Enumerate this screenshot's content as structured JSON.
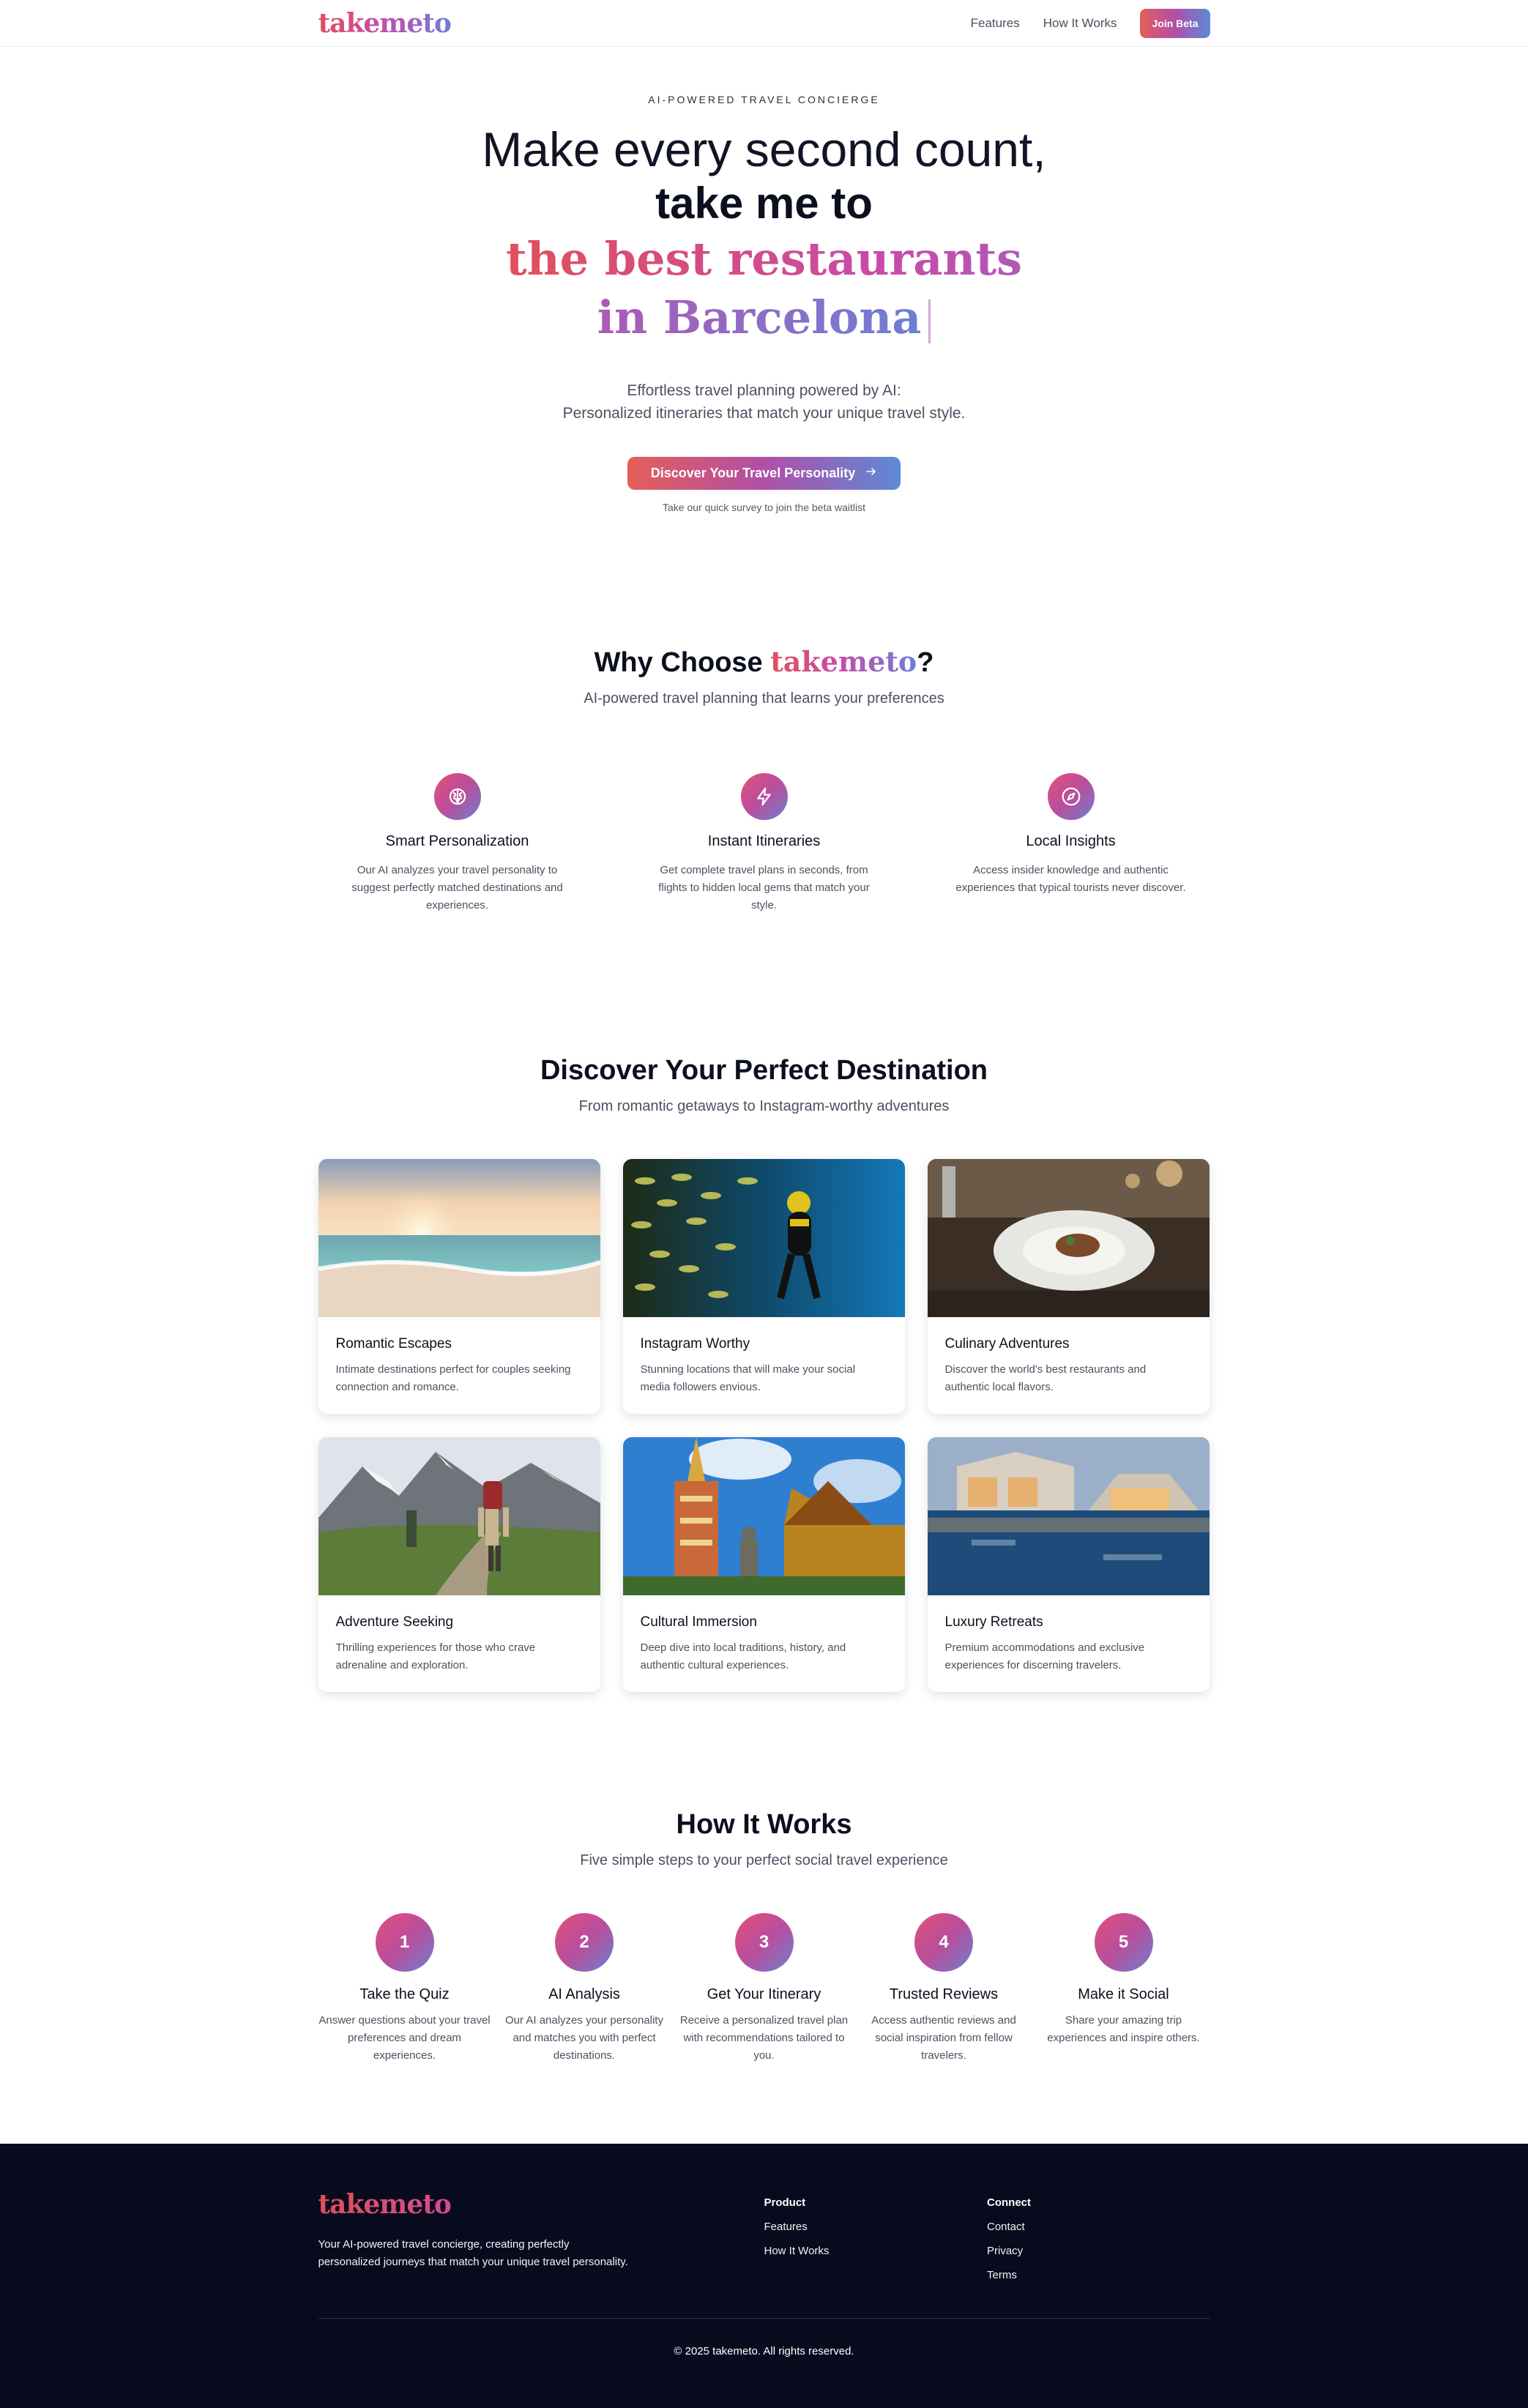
{
  "nav": {
    "logo": "takemeto",
    "links": [
      "Features",
      "How It Works"
    ],
    "cta": "Join Beta"
  },
  "hero": {
    "eyebrow": "AI-POWERED TRAVEL CONCIERGE",
    "line1": "Make every second count,",
    "line2": "take me to",
    "line3": "the best restaurants in Barcelona",
    "sub1": "Effortless travel planning powered by AI:",
    "sub2": "Personalized itineraries that match your unique travel style.",
    "cta": "Discover Your Travel Personality",
    "cta_icon": "arrow-right-icon",
    "note": "Take our quick survey to join the beta waitlist"
  },
  "why": {
    "title_prefix": "Why Choose ",
    "title_brand": "takemeto",
    "title_suffix": "?",
    "subtitle": "AI-powered travel planning that learns your preferences",
    "features": [
      {
        "icon": "brain-icon",
        "title": "Smart Personalization",
        "desc": "Our AI analyzes your travel personality to suggest perfectly matched destinations and experiences."
      },
      {
        "icon": "lightning-icon",
        "title": "Instant Itineraries",
        "desc": "Get complete travel plans in seconds, from flights to hidden local gems that match your style."
      },
      {
        "icon": "compass-icon",
        "title": "Local Insights",
        "desc": "Access insider knowledge and authentic experiences that typical tourists never discover."
      }
    ]
  },
  "destinations": {
    "title": "Discover Your Perfect Destination",
    "subtitle": "From romantic getaways to Instagram-worthy adventures",
    "cards": [
      {
        "title": "Romantic Escapes",
        "desc": "Intimate destinations perfect for couples seeking connection and romance."
      },
      {
        "title": "Instagram Worthy",
        "desc": "Stunning locations that will make your social media followers envious."
      },
      {
        "title": "Culinary Adventures",
        "desc": "Discover the world's best restaurants and authentic local flavors."
      },
      {
        "title": "Adventure Seeking",
        "desc": "Thrilling experiences for those who crave adrenaline and exploration."
      },
      {
        "title": "Cultural Immersion",
        "desc": "Deep dive into local traditions, history, and authentic cultural experiences."
      },
      {
        "title": "Luxury Retreats",
        "desc": "Premium accommodations and exclusive experiences for discerning travelers."
      }
    ]
  },
  "how": {
    "title": "How It Works",
    "subtitle": "Five simple steps to your perfect social travel experience",
    "steps": [
      {
        "num": "1",
        "title": "Take the Quiz",
        "desc": "Answer questions about your travel preferences and dream experiences."
      },
      {
        "num": "2",
        "title": "AI Analysis",
        "desc": "Our AI analyzes your personality and matches you with perfect destinations."
      },
      {
        "num": "3",
        "title": "Get Your Itinerary",
        "desc": "Receive a personalized travel plan with recommendations tailored to you."
      },
      {
        "num": "4",
        "title": "Trusted Reviews",
        "desc": "Access authentic reviews and social inspiration from fellow travelers."
      },
      {
        "num": "5",
        "title": "Make it Social",
        "desc": "Share your amazing trip experiences and inspire others."
      }
    ]
  },
  "footer": {
    "logo": "takemeto",
    "desc": "Your AI-powered travel concierge, creating perfectly personalized journeys that match your unique travel personality.",
    "product": {
      "heading": "Product",
      "links": [
        "Features",
        "How It Works"
      ]
    },
    "connect": {
      "heading": "Connect",
      "links": [
        "Contact",
        "Privacy",
        "Terms"
      ]
    },
    "copyright": "© 2025 takemeto. All rights reserved."
  }
}
